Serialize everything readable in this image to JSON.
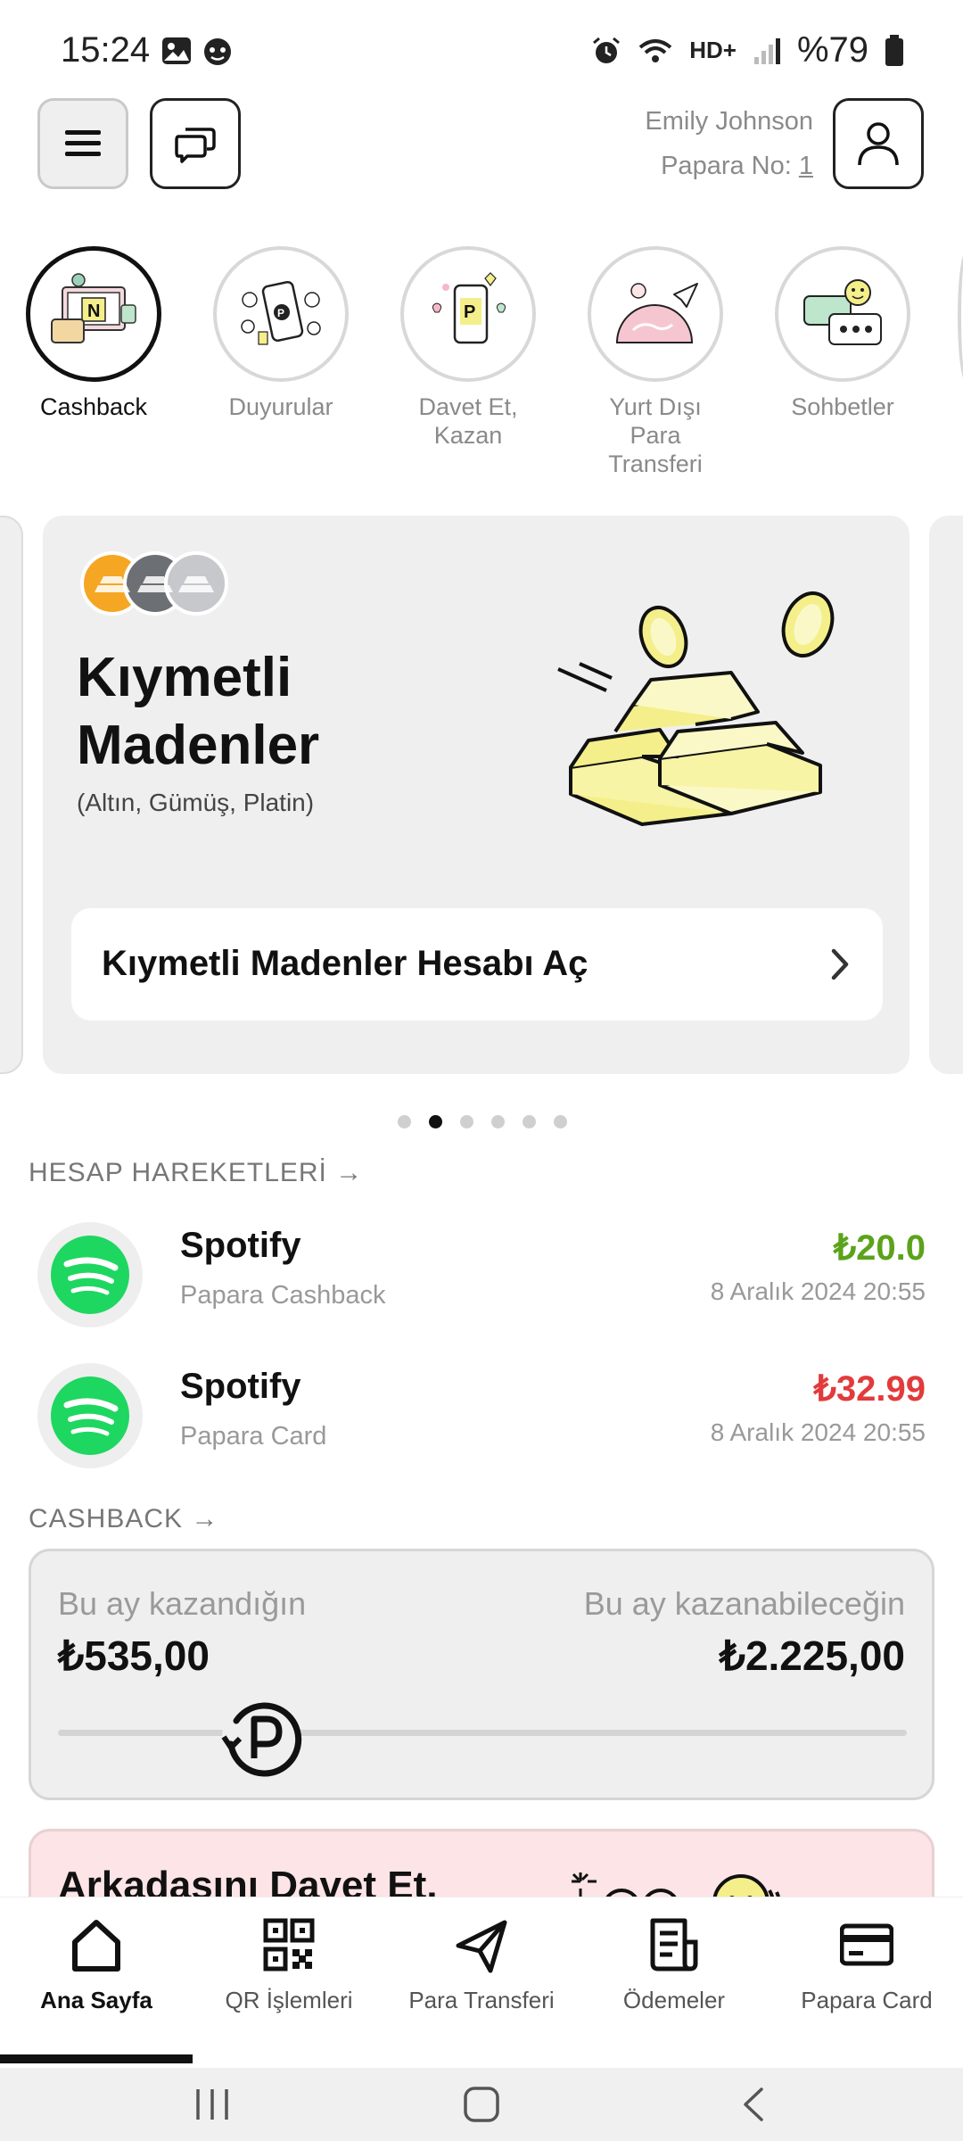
{
  "status_bar": {
    "time": "15:24",
    "battery": "%79",
    "net_label": "HD+"
  },
  "header": {
    "user_name": "Emily Johnson",
    "papara_no_label": "Papara No:",
    "papara_no_value": "1"
  },
  "stories": [
    {
      "label": "Cashback"
    },
    {
      "label": "Duyurular"
    },
    {
      "label": "Davet Et,\nKazan"
    },
    {
      "label": "Yurt Dışı Para\nTransferi"
    },
    {
      "label": "Sohbetler"
    }
  ],
  "carousel": {
    "title_line1": "Kıymetli",
    "title_line2": "Madenler",
    "subtitle": "(Altın, Gümüş, Platin)",
    "cta": "Kıymetli Madenler Hesabı Aç",
    "total_pages": 6,
    "active_page": 2
  },
  "transactions_section": {
    "title": "HESAP HAREKETLERİ →"
  },
  "transactions": [
    {
      "merchant": "Spotify",
      "type": "Papara Cashback",
      "amount": "₺20.0",
      "date": "8 Aralık 2024 20:55",
      "amount_color": "#5aa31a"
    },
    {
      "merchant": "Spotify",
      "type": "Papara Card",
      "amount": "₺32.99",
      "date": "8 Aralık 2024 20:55",
      "amount_color": "#e23b3b"
    }
  ],
  "cashback_section": {
    "title": "CASHBACK →"
  },
  "cashback": {
    "earned_label": "Bu ay kazandığın",
    "earned_value": "₺535,00",
    "potential_label": "Bu ay kazanabileceğin",
    "potential_value": "₺2.225,00",
    "progress_fraction": 0.24
  },
  "invite": {
    "title": "Arkadaşını Davet Et,"
  },
  "bottom_nav": [
    {
      "label": "Ana Sayfa",
      "icon": "home-icon"
    },
    {
      "label": "QR İşlemleri",
      "icon": "qr-icon"
    },
    {
      "label": "Para Transferi",
      "icon": "send-icon"
    },
    {
      "label": "Ödemeler",
      "icon": "payments-icon"
    },
    {
      "label": "Papara Card",
      "icon": "card-icon"
    }
  ],
  "colors": {
    "spotify_green": "#1ed760",
    "accent_yellow": "#f7f09a",
    "coin_gold": "#f5a623"
  }
}
